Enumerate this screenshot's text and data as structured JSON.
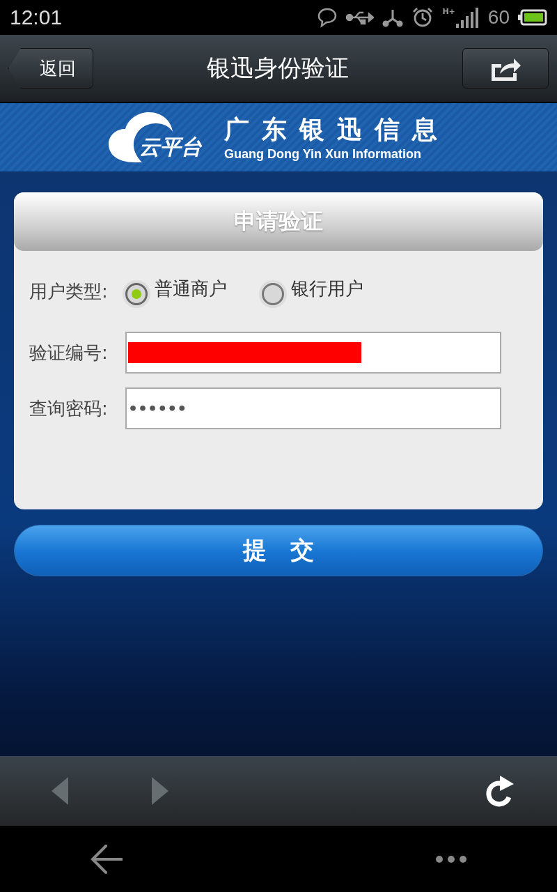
{
  "status_bar": {
    "time": "12:01",
    "network": "H+",
    "battery": "60"
  },
  "nav": {
    "back": "返回",
    "title": "银迅身份验证"
  },
  "banner": {
    "logo_text": "云平台",
    "name": "广东银迅信息",
    "subtitle": "Guang Dong Yin Xun Information"
  },
  "card": {
    "title": "申请验证",
    "user_type": {
      "label": "用户类型:",
      "options": [
        {
          "label": "普通商户",
          "selected": true
        },
        {
          "label": "银行用户",
          "selected": false
        }
      ]
    },
    "fields": [
      {
        "label": "验证编号:",
        "kind": "redacted"
      },
      {
        "label": "查询密码:",
        "kind": "password",
        "value": "••••••"
      }
    ]
  },
  "submit": "提　交"
}
